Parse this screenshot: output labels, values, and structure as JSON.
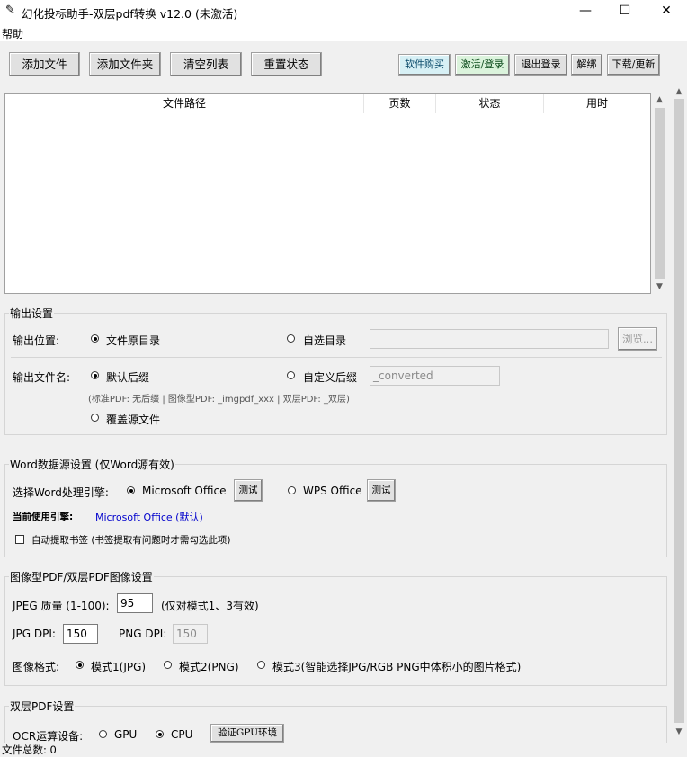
{
  "window": {
    "title": "幻化投标助手-双层pdf转换 v12.0 (未激活)",
    "minimize": "—",
    "maximize": "☐",
    "close": "✕",
    "app_icon": "feather-icon"
  },
  "menu": {
    "help": "帮助"
  },
  "toolbar": {
    "add_file": "添加文件",
    "add_folder": "添加文件夹",
    "clear_list": "清空列表",
    "reset_status": "重置状态",
    "buy": "软件购买",
    "activate": "激活/登录",
    "logout": "退出登录",
    "unbind": "解绑",
    "download": "下载/更新"
  },
  "table": {
    "columns": [
      "文件路径",
      "页数",
      "状态",
      "用时"
    ],
    "rows": []
  },
  "output": {
    "group_title": "输出设置",
    "location_label": "输出位置:",
    "location_original": "文件原目录",
    "location_custom": "自选目录",
    "custom_dir_value": "",
    "browse": "浏览...",
    "filename_label": "输出文件名:",
    "suffix_default": "默认后缀",
    "suffix_custom": "自定义后缀",
    "suffix_value": "_converted",
    "hint": "(标准PDF: 无后缀 | 图像型PDF: _imgpdf_xxx | 双层PDF: _双层)",
    "overwrite": "覆盖源文件"
  },
  "word": {
    "group_title": "Word数据源设置 (仅Word源有效)",
    "engine_label": "选择Word处理引擎:",
    "ms_office": "Microsoft Office",
    "test": "测试",
    "wps_office": "WPS Office",
    "current_label": "当前使用引擎:",
    "current_value": "Microsoft Office (默认)",
    "bookmark": "自动提取书签 (书签提取有问题时才需勾选此项)"
  },
  "image": {
    "group_title": "图像型PDF/双层PDF图像设置",
    "jpeg_quality_label": "JPEG 质量 (1-100):",
    "jpeg_quality_value": "95",
    "jpeg_note": "(仅对模式1、3有效)",
    "jpg_dpi_label": "JPG DPI:",
    "jpg_dpi_value": "150",
    "png_dpi_label": "PNG DPI:",
    "png_dpi_value": "150",
    "format_label": "图像格式:",
    "mode1": "模式1(JPG)",
    "mode2": "模式2(PNG)",
    "mode3": "模式3(智能选择JPG/RGB PNG中体积小的图片格式)"
  },
  "dual": {
    "group_title": "双层PDF设置",
    "ocr_label": "OCR运算设备:",
    "gpu": "GPU",
    "cpu": "CPU",
    "verify_gpu": "验证GPU环境"
  },
  "status": {
    "file_count": "文件总数: 0"
  }
}
